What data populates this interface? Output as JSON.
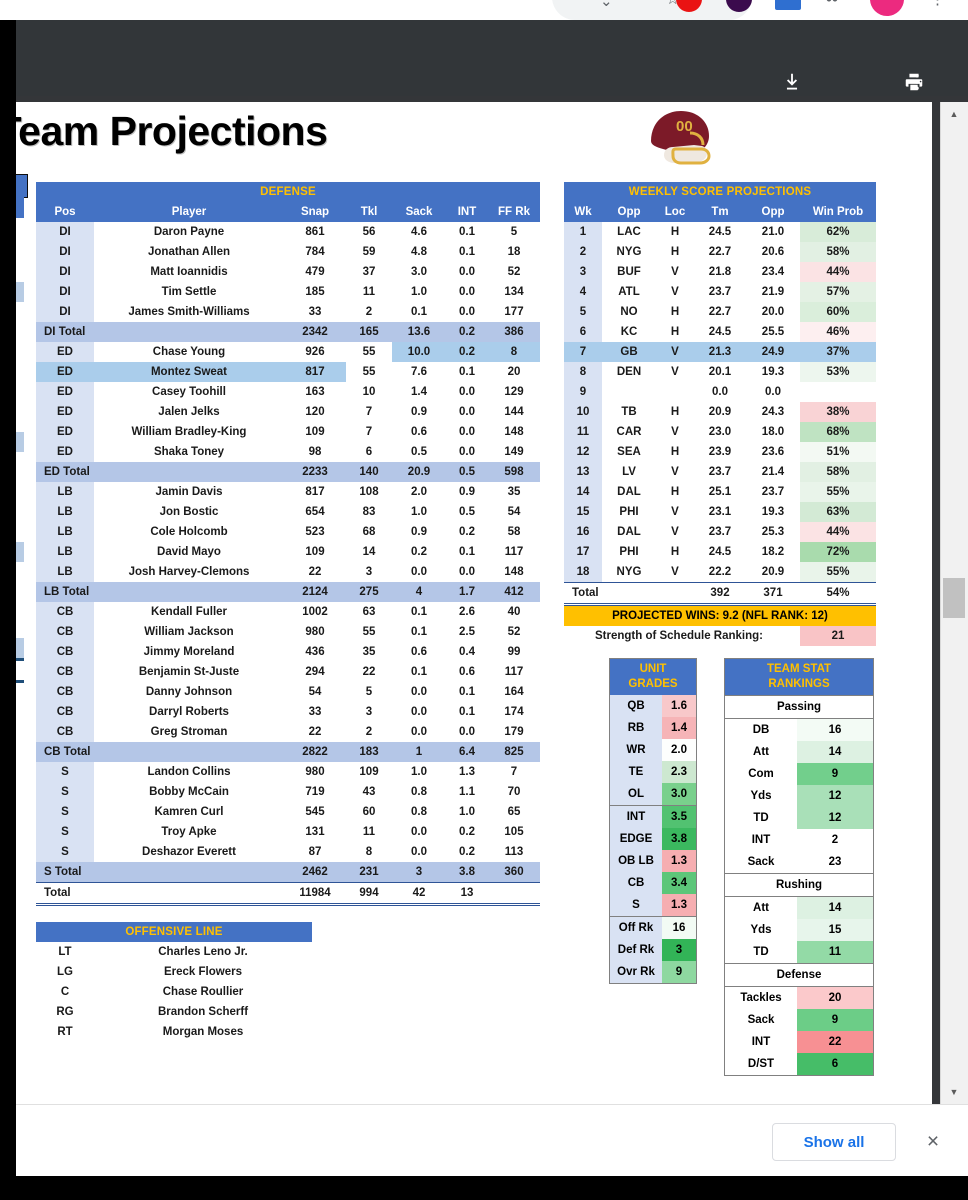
{
  "browser": {
    "extension_icons": [
      "red-circle-icon",
      "purple-circle-icon",
      "blue-square-icon",
      "dots-icon",
      "pink-circle-icon"
    ],
    "omnibox_glyphs": [
      "chevron-down-icon",
      "star-icon",
      "more-vertical-icon"
    ]
  },
  "pdf_toolbar": {
    "download_label": "Download",
    "print_label": "Print",
    "more_label": "More actions"
  },
  "document": {
    "title": "tball Team Projections",
    "full_title_hint": "tball Team Projections",
    "logo": "washington-football-helmet"
  },
  "defense": {
    "banner": "DEFENSE",
    "columns": [
      "Pos",
      "Player",
      "Snap",
      "Tkl",
      "Sack",
      "INT",
      "FF Rk"
    ],
    "rows": [
      {
        "pos": "DI",
        "player": "Daron Payne",
        "snap": "861",
        "tkl": "56",
        "sack": "4.6",
        "int": "0.1",
        "ffrk": "5"
      },
      {
        "pos": "DI",
        "player": "Jonathan Allen",
        "snap": "784",
        "tkl": "59",
        "sack": "4.8",
        "int": "0.1",
        "ffrk": "18"
      },
      {
        "pos": "DI",
        "player": "Matt Ioannidis",
        "snap": "479",
        "tkl": "37",
        "sack": "3.0",
        "int": "0.0",
        "ffrk": "52"
      },
      {
        "pos": "DI",
        "player": "Tim Settle",
        "snap": "185",
        "tkl": "11",
        "sack": "1.0",
        "int": "0.0",
        "ffrk": "134"
      },
      {
        "pos": "DI",
        "player": "James Smith-Williams",
        "snap": "33",
        "tkl": "2",
        "sack": "0.1",
        "int": "0.0",
        "ffrk": "177"
      },
      {
        "pos": "DI Total",
        "player": "",
        "snap": "2342",
        "tkl": "165",
        "sack": "13.6",
        "int": "0.2",
        "ffrk": "386",
        "total": true
      },
      {
        "pos": "ED",
        "player": "Chase Young",
        "snap": "926",
        "tkl": "55",
        "sack": "10.0",
        "int": "0.2",
        "ffrk": "8",
        "sel": [
          "sack",
          "int",
          "ffrk"
        ]
      },
      {
        "pos": "ED",
        "player": "Montez Sweat",
        "snap": "817",
        "tkl": "55",
        "sack": "7.6",
        "int": "0.1",
        "ffrk": "20",
        "sel": [
          "pos",
          "player",
          "snap"
        ]
      },
      {
        "pos": "ED",
        "player": "Casey Toohill",
        "snap": "163",
        "tkl": "10",
        "sack": "1.4",
        "int": "0.0",
        "ffrk": "129"
      },
      {
        "pos": "ED",
        "player": "Jalen Jelks",
        "snap": "120",
        "tkl": "7",
        "sack": "0.9",
        "int": "0.0",
        "ffrk": "144"
      },
      {
        "pos": "ED",
        "player": "William Bradley-King",
        "snap": "109",
        "tkl": "7",
        "sack": "0.6",
        "int": "0.0",
        "ffrk": "148"
      },
      {
        "pos": "ED",
        "player": "Shaka Toney",
        "snap": "98",
        "tkl": "6",
        "sack": "0.5",
        "int": "0.0",
        "ffrk": "149"
      },
      {
        "pos": "ED Total",
        "player": "",
        "snap": "2233",
        "tkl": "140",
        "sack": "20.9",
        "int": "0.5",
        "ffrk": "598",
        "total": true
      },
      {
        "pos": "LB",
        "player": "Jamin Davis",
        "snap": "817",
        "tkl": "108",
        "sack": "2.0",
        "int": "0.9",
        "ffrk": "35"
      },
      {
        "pos": "LB",
        "player": "Jon Bostic",
        "snap": "654",
        "tkl": "83",
        "sack": "1.0",
        "int": "0.5",
        "ffrk": "54"
      },
      {
        "pos": "LB",
        "player": "Cole Holcomb",
        "snap": "523",
        "tkl": "68",
        "sack": "0.9",
        "int": "0.2",
        "ffrk": "58"
      },
      {
        "pos": "LB",
        "player": "David Mayo",
        "snap": "109",
        "tkl": "14",
        "sack": "0.2",
        "int": "0.1",
        "ffrk": "117"
      },
      {
        "pos": "LB",
        "player": "Josh Harvey-Clemons",
        "snap": "22",
        "tkl": "3",
        "sack": "0.0",
        "int": "0.0",
        "ffrk": "148"
      },
      {
        "pos": "LB Total",
        "player": "",
        "snap": "2124",
        "tkl": "275",
        "sack": "4",
        "int": "1.7",
        "ffrk": "412",
        "total": true
      },
      {
        "pos": "CB",
        "player": "Kendall Fuller",
        "snap": "1002",
        "tkl": "63",
        "sack": "0.1",
        "int": "2.6",
        "ffrk": "40"
      },
      {
        "pos": "CB",
        "player": "William Jackson",
        "snap": "980",
        "tkl": "55",
        "sack": "0.1",
        "int": "2.5",
        "ffrk": "52"
      },
      {
        "pos": "CB",
        "player": "Jimmy Moreland",
        "snap": "436",
        "tkl": "35",
        "sack": "0.6",
        "int": "0.4",
        "ffrk": "99"
      },
      {
        "pos": "CB",
        "player": "Benjamin St-Juste",
        "snap": "294",
        "tkl": "22",
        "sack": "0.1",
        "int": "0.6",
        "ffrk": "117"
      },
      {
        "pos": "CB",
        "player": "Danny Johnson",
        "snap": "54",
        "tkl": "5",
        "sack": "0.0",
        "int": "0.1",
        "ffrk": "164"
      },
      {
        "pos": "CB",
        "player": "Darryl Roberts",
        "snap": "33",
        "tkl": "3",
        "sack": "0.0",
        "int": "0.1",
        "ffrk": "174"
      },
      {
        "pos": "CB",
        "player": "Greg Stroman",
        "snap": "22",
        "tkl": "2",
        "sack": "0.0",
        "int": "0.0",
        "ffrk": "179"
      },
      {
        "pos": "CB Total",
        "player": "",
        "snap": "2822",
        "tkl": "183",
        "sack": "1",
        "int": "6.4",
        "ffrk": "825",
        "total": true
      },
      {
        "pos": "S",
        "player": "Landon Collins",
        "snap": "980",
        "tkl": "109",
        "sack": "1.0",
        "int": "1.3",
        "ffrk": "7"
      },
      {
        "pos": "S",
        "player": "Bobby McCain",
        "snap": "719",
        "tkl": "43",
        "sack": "0.8",
        "int": "1.1",
        "ffrk": "70"
      },
      {
        "pos": "S",
        "player": "Kamren Curl",
        "snap": "545",
        "tkl": "60",
        "sack": "0.8",
        "int": "1.0",
        "ffrk": "65"
      },
      {
        "pos": "S",
        "player": "Troy Apke",
        "snap": "131",
        "tkl": "11",
        "sack": "0.0",
        "int": "0.2",
        "ffrk": "105"
      },
      {
        "pos": "S",
        "player": "Deshazor Everett",
        "snap": "87",
        "tkl": "8",
        "sack": "0.0",
        "int": "0.2",
        "ffrk": "113"
      },
      {
        "pos": "S Total",
        "player": "",
        "snap": "2462",
        "tkl": "231",
        "sack": "3",
        "int": "3.8",
        "ffrk": "360",
        "total": true
      },
      {
        "pos": "Total",
        "player": "",
        "snap": "11984",
        "tkl": "994",
        "sack": "42",
        "int": "13",
        "ffrk": "",
        "grand": true
      }
    ]
  },
  "offensive_line": {
    "banner": "OFFENSIVE LINE",
    "rows": [
      {
        "pos": "LT",
        "player": "Charles Leno Jr."
      },
      {
        "pos": "LG",
        "player": "Ereck Flowers"
      },
      {
        "pos": "C",
        "player": "Chase Roullier"
      },
      {
        "pos": "RG",
        "player": "Brandon Scherff"
      },
      {
        "pos": "RT",
        "player": "Morgan Moses"
      }
    ]
  },
  "weekly": {
    "banner": "WEEKLY SCORE PROJECTIONS",
    "columns": [
      "Wk",
      "Opp",
      "Loc",
      "Tm",
      "Opp",
      "Win Prob"
    ],
    "rows": [
      {
        "wk": "1",
        "opp": "LAC",
        "loc": "H",
        "tm": "24.5",
        "opp2": "21.0",
        "win": "62%",
        "wincolor": "#d8ecd9"
      },
      {
        "wk": "2",
        "opp": "NYG",
        "loc": "H",
        "tm": "22.7",
        "opp2": "20.6",
        "win": "58%",
        "wincolor": "#e2f0e3"
      },
      {
        "wk": "3",
        "opp": "BUF",
        "loc": "V",
        "tm": "21.8",
        "opp2": "23.4",
        "win": "44%",
        "wincolor": "#fbe3e4"
      },
      {
        "wk": "4",
        "opp": "ATL",
        "loc": "V",
        "tm": "23.7",
        "opp2": "21.9",
        "win": "57%",
        "wincolor": "#e4f1e4"
      },
      {
        "wk": "5",
        "opp": "NO",
        "loc": "H",
        "tm": "22.7",
        "opp2": "20.0",
        "win": "60%",
        "wincolor": "#daeedb"
      },
      {
        "wk": "6",
        "opp": "KC",
        "loc": "H",
        "tm": "24.5",
        "opp2": "25.5",
        "win": "46%",
        "wincolor": "#fdeff0"
      },
      {
        "wk": "7",
        "opp": "GB",
        "loc": "V",
        "tm": "21.3",
        "opp2": "24.9",
        "win": "37%",
        "wincolor": "#f8cdcf",
        "sel": [
          "wk",
          "opp",
          "loc",
          "tm",
          "opp2",
          "win"
        ]
      },
      {
        "wk": "8",
        "opp": "DEN",
        "loc": "V",
        "tm": "20.1",
        "opp2": "19.3",
        "win": "53%",
        "wincolor": "#edf6ee"
      },
      {
        "wk": "9",
        "opp": "",
        "loc": "",
        "tm": "0.0",
        "opp2": "0.0",
        "win": "",
        "wincolor": "#ffffff"
      },
      {
        "wk": "10",
        "opp": "TB",
        "loc": "H",
        "tm": "20.9",
        "opp2": "24.3",
        "win": "38%",
        "wincolor": "#f9d3d5"
      },
      {
        "wk": "11",
        "opp": "CAR",
        "loc": "V",
        "tm": "23.0",
        "opp2": "18.0",
        "win": "68%",
        "wincolor": "#bfe3c2"
      },
      {
        "wk": "12",
        "opp": "SEA",
        "loc": "H",
        "tm": "23.9",
        "opp2": "23.6",
        "win": "51%",
        "wincolor": "#f3f9f3"
      },
      {
        "wk": "13",
        "opp": "LV",
        "loc": "V",
        "tm": "23.7",
        "opp2": "21.4",
        "win": "58%",
        "wincolor": "#e2f0e3"
      },
      {
        "wk": "14",
        "opp": "DAL",
        "loc": "H",
        "tm": "25.1",
        "opp2": "23.7",
        "win": "55%",
        "wincolor": "#e9f4ea"
      },
      {
        "wk": "15",
        "opp": "PHI",
        "loc": "V",
        "tm": "23.1",
        "opp2": "19.3",
        "win": "63%",
        "wincolor": "#d3ead5"
      },
      {
        "wk": "16",
        "opp": "DAL",
        "loc": "V",
        "tm": "23.7",
        "opp2": "25.3",
        "win": "44%",
        "wincolor": "#fbe3e4"
      },
      {
        "wk": "17",
        "opp": "PHI",
        "loc": "H",
        "tm": "24.5",
        "opp2": "18.2",
        "win": "72%",
        "wincolor": "#a9dbad"
      },
      {
        "wk": "18",
        "opp": "NYG",
        "loc": "V",
        "tm": "22.2",
        "opp2": "20.9",
        "win": "55%",
        "wincolor": "#e9f4ea"
      }
    ],
    "total": {
      "label": "Total",
      "tm": "392",
      "opp2": "371",
      "win": "54%"
    },
    "projected_wins": "PROJECTED WINS: 9.2 (NFL RANK: 12)",
    "sos_label": "Strength of Schedule Ranking:",
    "sos_value": "21",
    "sos_color": "#f9c4c6"
  },
  "unit_grades": {
    "banner_line1": "UNIT",
    "banner_line2": "GRADES",
    "groups": [
      {
        "rows": [
          {
            "label": "QB",
            "value": "1.6",
            "color": "#f8c8ca"
          },
          {
            "label": "RB",
            "value": "1.4",
            "color": "#f6b4b7"
          },
          {
            "label": "WR",
            "value": "2.0",
            "color": "#fdfefd"
          },
          {
            "label": "TE",
            "value": "2.3",
            "color": "#cde8d0"
          },
          {
            "label": "OL",
            "value": "3.0",
            "color": "#79d08c"
          }
        ]
      },
      {
        "rows": [
          {
            "label": "INT",
            "value": "3.5",
            "color": "#52c271"
          },
          {
            "label": "EDGE",
            "value": "3.8",
            "color": "#3bb85f"
          },
          {
            "label": "OB LB",
            "value": "1.3",
            "color": "#f6aeb1"
          },
          {
            "label": "CB",
            "value": "3.4",
            "color": "#5cc679"
          },
          {
            "label": "S",
            "value": "1.3",
            "color": "#f6aeb1"
          }
        ]
      },
      {
        "rows": [
          {
            "label": "Off Rk",
            "value": "16",
            "color": "#f2fbf4"
          },
          {
            "label": "Def Rk",
            "value": "3",
            "color": "#32b457"
          },
          {
            "label": "Ovr Rk",
            "value": "9",
            "color": "#8ed8a0"
          }
        ]
      }
    ]
  },
  "team_stat_rankings": {
    "banner_line1": "TEAM STAT",
    "banner_line2": "RANKINGS",
    "sections": [
      {
        "title": "Passing",
        "rows": [
          {
            "label": "DB",
            "value": "16",
            "color": "#f3fbf5"
          },
          {
            "label": "Att",
            "value": "14",
            "color": "#ddf1e2"
          },
          {
            "label": "Com",
            "value": "9",
            "color": "#72cf8c"
          },
          {
            "label": "Yds",
            "value": "12",
            "color": "#a9e0b8"
          },
          {
            "label": "TD",
            "value": "12",
            "color": "#a9e0b8"
          },
          {
            "label": "INT",
            "value": "2",
            "color": "#ffffff"
          },
          {
            "label": "Sack",
            "value": "23",
            "color": "#ffffff"
          }
        ]
      },
      {
        "title": "Rushing",
        "rows": [
          {
            "label": "Att",
            "value": "14",
            "color": "#ddf1e2"
          },
          {
            "label": "Yds",
            "value": "15",
            "color": "#e7f5eb"
          },
          {
            "label": "TD",
            "value": "11",
            "color": "#93daa6"
          }
        ]
      },
      {
        "title": "Defense",
        "rows": [
          {
            "label": "Tackles",
            "value": "20",
            "color": "#fbc9cb"
          },
          {
            "label": "Sack",
            "value": "9",
            "color": "#6ccd87"
          },
          {
            "label": "INT",
            "value": "22",
            "color": "#f79093"
          },
          {
            "label": "D/ST",
            "value": "6",
            "color": "#46bd68"
          }
        ]
      }
    ]
  },
  "downloads_bar": {
    "show_all_label": "Show all",
    "close_label": "×"
  },
  "scrollbar": {
    "up_arrow": "▲",
    "down_arrow": "▼"
  },
  "colors": {
    "header_blue": "#4472c4",
    "banner_gold": "#ffc000",
    "total_row": "#b4c6e7",
    "pos_cell": "#d9e2f3",
    "toolbar_dark": "#323639",
    "link_blue": "#1a73e8"
  }
}
